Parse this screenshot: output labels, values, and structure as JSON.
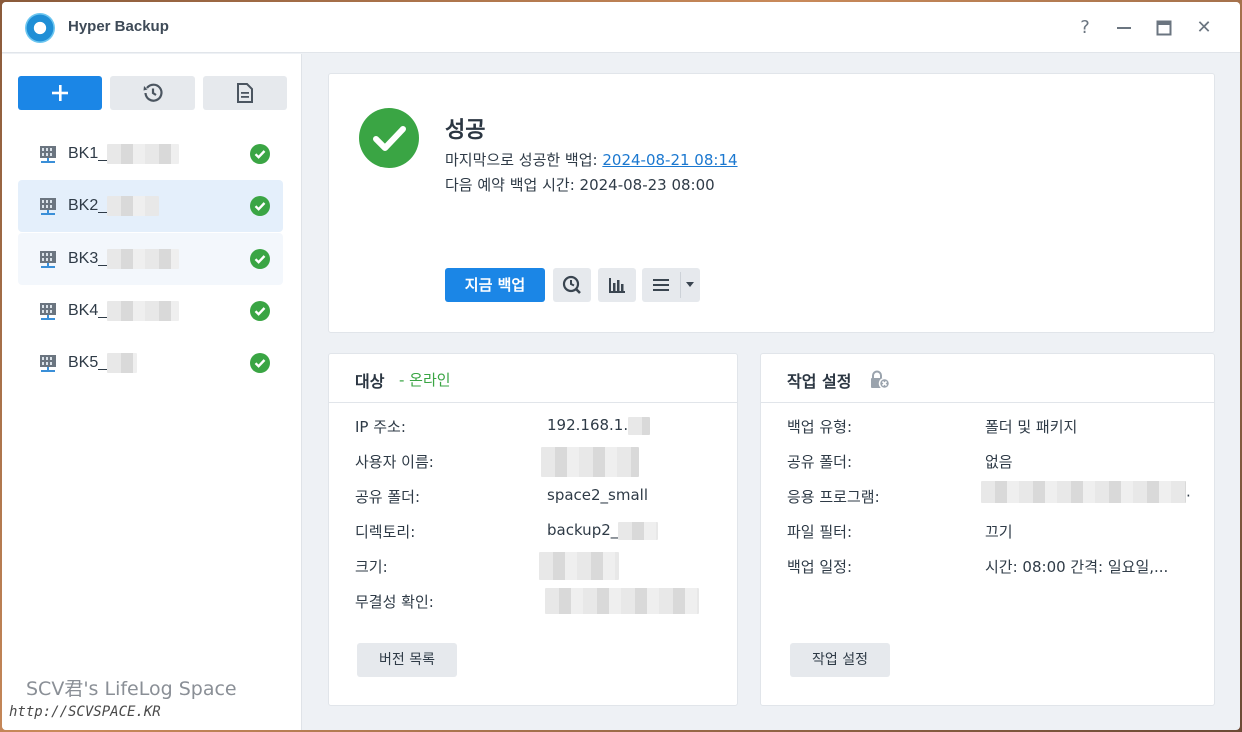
{
  "window": {
    "title": "Hyper Backup",
    "help_icon": "help-icon",
    "minimize_icon": "minimize-icon",
    "maximize_icon": "maximize-icon",
    "close_icon": "close-icon",
    "help_glyph": "?",
    "close_glyph": "✕"
  },
  "toolbar": {
    "add_icon": "plus-icon",
    "restore_icon": "restore-history-icon",
    "log_icon": "log-document-icon"
  },
  "tasks": [
    {
      "name": "BK1_",
      "status": "success"
    },
    {
      "name": "BK2_",
      "status": "success"
    },
    {
      "name": "BK3_",
      "status": "success"
    },
    {
      "name": "BK4_",
      "status": "success"
    },
    {
      "name": "BK5_",
      "status": "success"
    }
  ],
  "watermark": {
    "line1": "SCV君's LifeLog Space",
    "line2": "http://SCVSPACE.KR"
  },
  "status": {
    "title": "성공",
    "last_success_label": "마지막으로 성공한 백업: ",
    "last_success_value": "2024-08-21 08:14",
    "next_schedule": "다음 예약 백업 시간: 2024-08-23 08:00",
    "backup_now_label": "지금 백업"
  },
  "target": {
    "title": "대상",
    "subtitle": "- 온라인",
    "rows": [
      {
        "label": "IP 주소:",
        "value": "192.168.1."
      },
      {
        "label": "사용자 이름:",
        "value": ""
      },
      {
        "label": "공유 폴더:",
        "value": "space2_small"
      },
      {
        "label": "디렉토리:",
        "value": "backup2_"
      },
      {
        "label": "크기:",
        "value": ""
      },
      {
        "label": "무결성 확인:",
        "value": ""
      }
    ],
    "version_list_label": "버전 목록"
  },
  "settings": {
    "title": "작업 설정",
    "rows": [
      {
        "label": "백업 유형:",
        "value": "폴더 및 패키지"
      },
      {
        "label": "공유 폴더:",
        "value": "없음"
      },
      {
        "label": "응용 프로그램:",
        "value": "."
      },
      {
        "label": "파일 필터:",
        "value": "끄기"
      },
      {
        "label": "백업 일정:",
        "value": "시간: 08:00 간격: 일요일,..."
      }
    ],
    "task_settings_label": "작업 설정"
  },
  "colors": {
    "accent": "#1b86e6",
    "success": "#3aa544",
    "link": "#1b78d0"
  }
}
